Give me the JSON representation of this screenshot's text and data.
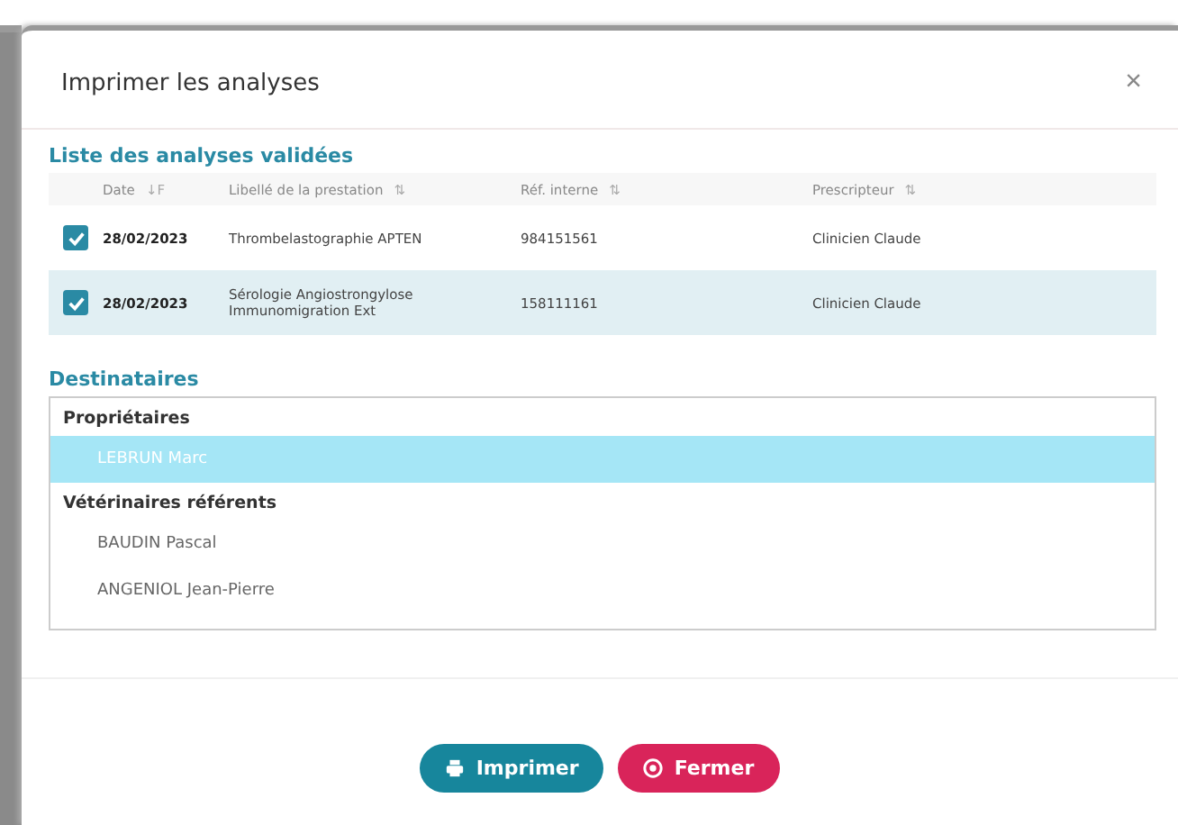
{
  "dialog": {
    "title": "Imprimer les analyses",
    "close": "×"
  },
  "analyses": {
    "title": "Liste des analyses validées",
    "columns": [
      {
        "label": "Date",
        "sort": "↓F"
      },
      {
        "label": "Libellé de la prestation",
        "sort": "⇅"
      },
      {
        "label": "Réf. interne",
        "sort": "⇅"
      },
      {
        "label": "Prescripteur",
        "sort": "⇅"
      }
    ],
    "rows": [
      {
        "checked": true,
        "selected": false,
        "date": "28/02/2023",
        "label": "Thrombelastographie APTEN",
        "ref": "984151561",
        "prescriber": "Clinicien Claude"
      },
      {
        "checked": true,
        "selected": true,
        "date": "28/02/2023",
        "label": "Sérologie Angiostrongylose Immunomigration Ext",
        "ref": "158111161",
        "prescriber": "Clinicien Claude"
      }
    ]
  },
  "recipients": {
    "title": "Destinataires",
    "groups": [
      {
        "label": "Propriétaires",
        "items": [
          {
            "name": "LEBRUN Marc",
            "selected": true
          }
        ]
      },
      {
        "label": "Vétérinaires référents",
        "items": [
          {
            "name": "BAUDIN Pascal",
            "selected": false
          },
          {
            "name": "ANGENIOL Jean-Pierre",
            "selected": false
          }
        ]
      }
    ]
  },
  "buttons": [
    {
      "kind": "print",
      "label": "Imprimer"
    },
    {
      "kind": "close",
      "label": "Fermer"
    }
  ]
}
